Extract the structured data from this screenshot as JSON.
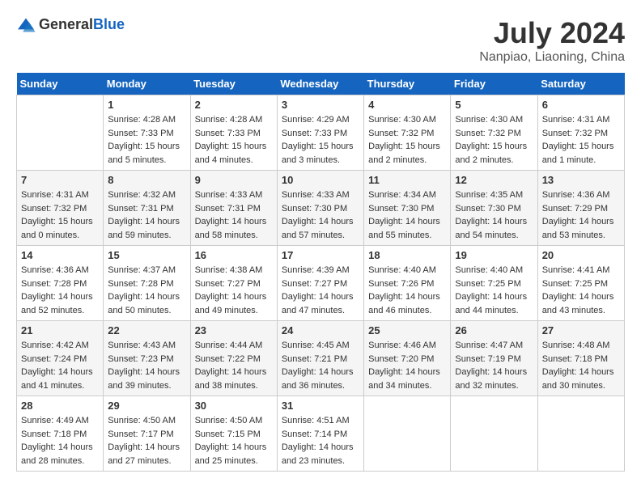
{
  "header": {
    "logo_general": "General",
    "logo_blue": "Blue",
    "month_year": "July 2024",
    "location": "Nanpiao, Liaoning, China"
  },
  "days_of_week": [
    "Sunday",
    "Monday",
    "Tuesday",
    "Wednesday",
    "Thursday",
    "Friday",
    "Saturday"
  ],
  "weeks": [
    [
      {
        "day": "",
        "sunrise": "",
        "sunset": "",
        "daylight": ""
      },
      {
        "day": "1",
        "sunrise": "Sunrise: 4:28 AM",
        "sunset": "Sunset: 7:33 PM",
        "daylight": "Daylight: 15 hours and 5 minutes."
      },
      {
        "day": "2",
        "sunrise": "Sunrise: 4:28 AM",
        "sunset": "Sunset: 7:33 PM",
        "daylight": "Daylight: 15 hours and 4 minutes."
      },
      {
        "day": "3",
        "sunrise": "Sunrise: 4:29 AM",
        "sunset": "Sunset: 7:33 PM",
        "daylight": "Daylight: 15 hours and 3 minutes."
      },
      {
        "day": "4",
        "sunrise": "Sunrise: 4:30 AM",
        "sunset": "Sunset: 7:32 PM",
        "daylight": "Daylight: 15 hours and 2 minutes."
      },
      {
        "day": "5",
        "sunrise": "Sunrise: 4:30 AM",
        "sunset": "Sunset: 7:32 PM",
        "daylight": "Daylight: 15 hours and 2 minutes."
      },
      {
        "day": "6",
        "sunrise": "Sunrise: 4:31 AM",
        "sunset": "Sunset: 7:32 PM",
        "daylight": "Daylight: 15 hours and 1 minute."
      }
    ],
    [
      {
        "day": "7",
        "sunrise": "Sunrise: 4:31 AM",
        "sunset": "Sunset: 7:32 PM",
        "daylight": "Daylight: 15 hours and 0 minutes."
      },
      {
        "day": "8",
        "sunrise": "Sunrise: 4:32 AM",
        "sunset": "Sunset: 7:31 PM",
        "daylight": "Daylight: 14 hours and 59 minutes."
      },
      {
        "day": "9",
        "sunrise": "Sunrise: 4:33 AM",
        "sunset": "Sunset: 7:31 PM",
        "daylight": "Daylight: 14 hours and 58 minutes."
      },
      {
        "day": "10",
        "sunrise": "Sunrise: 4:33 AM",
        "sunset": "Sunset: 7:30 PM",
        "daylight": "Daylight: 14 hours and 57 minutes."
      },
      {
        "day": "11",
        "sunrise": "Sunrise: 4:34 AM",
        "sunset": "Sunset: 7:30 PM",
        "daylight": "Daylight: 14 hours and 55 minutes."
      },
      {
        "day": "12",
        "sunrise": "Sunrise: 4:35 AM",
        "sunset": "Sunset: 7:30 PM",
        "daylight": "Daylight: 14 hours and 54 minutes."
      },
      {
        "day": "13",
        "sunrise": "Sunrise: 4:36 AM",
        "sunset": "Sunset: 7:29 PM",
        "daylight": "Daylight: 14 hours and 53 minutes."
      }
    ],
    [
      {
        "day": "14",
        "sunrise": "Sunrise: 4:36 AM",
        "sunset": "Sunset: 7:28 PM",
        "daylight": "Daylight: 14 hours and 52 minutes."
      },
      {
        "day": "15",
        "sunrise": "Sunrise: 4:37 AM",
        "sunset": "Sunset: 7:28 PM",
        "daylight": "Daylight: 14 hours and 50 minutes."
      },
      {
        "day": "16",
        "sunrise": "Sunrise: 4:38 AM",
        "sunset": "Sunset: 7:27 PM",
        "daylight": "Daylight: 14 hours and 49 minutes."
      },
      {
        "day": "17",
        "sunrise": "Sunrise: 4:39 AM",
        "sunset": "Sunset: 7:27 PM",
        "daylight": "Daylight: 14 hours and 47 minutes."
      },
      {
        "day": "18",
        "sunrise": "Sunrise: 4:40 AM",
        "sunset": "Sunset: 7:26 PM",
        "daylight": "Daylight: 14 hours and 46 minutes."
      },
      {
        "day": "19",
        "sunrise": "Sunrise: 4:40 AM",
        "sunset": "Sunset: 7:25 PM",
        "daylight": "Daylight: 14 hours and 44 minutes."
      },
      {
        "day": "20",
        "sunrise": "Sunrise: 4:41 AM",
        "sunset": "Sunset: 7:25 PM",
        "daylight": "Daylight: 14 hours and 43 minutes."
      }
    ],
    [
      {
        "day": "21",
        "sunrise": "Sunrise: 4:42 AM",
        "sunset": "Sunset: 7:24 PM",
        "daylight": "Daylight: 14 hours and 41 minutes."
      },
      {
        "day": "22",
        "sunrise": "Sunrise: 4:43 AM",
        "sunset": "Sunset: 7:23 PM",
        "daylight": "Daylight: 14 hours and 39 minutes."
      },
      {
        "day": "23",
        "sunrise": "Sunrise: 4:44 AM",
        "sunset": "Sunset: 7:22 PM",
        "daylight": "Daylight: 14 hours and 38 minutes."
      },
      {
        "day": "24",
        "sunrise": "Sunrise: 4:45 AM",
        "sunset": "Sunset: 7:21 PM",
        "daylight": "Daylight: 14 hours and 36 minutes."
      },
      {
        "day": "25",
        "sunrise": "Sunrise: 4:46 AM",
        "sunset": "Sunset: 7:20 PM",
        "daylight": "Daylight: 14 hours and 34 minutes."
      },
      {
        "day": "26",
        "sunrise": "Sunrise: 4:47 AM",
        "sunset": "Sunset: 7:19 PM",
        "daylight": "Daylight: 14 hours and 32 minutes."
      },
      {
        "day": "27",
        "sunrise": "Sunrise: 4:48 AM",
        "sunset": "Sunset: 7:18 PM",
        "daylight": "Daylight: 14 hours and 30 minutes."
      }
    ],
    [
      {
        "day": "28",
        "sunrise": "Sunrise: 4:49 AM",
        "sunset": "Sunset: 7:18 PM",
        "daylight": "Daylight: 14 hours and 28 minutes."
      },
      {
        "day": "29",
        "sunrise": "Sunrise: 4:50 AM",
        "sunset": "Sunset: 7:17 PM",
        "daylight": "Daylight: 14 hours and 27 minutes."
      },
      {
        "day": "30",
        "sunrise": "Sunrise: 4:50 AM",
        "sunset": "Sunset: 7:15 PM",
        "daylight": "Daylight: 14 hours and 25 minutes."
      },
      {
        "day": "31",
        "sunrise": "Sunrise: 4:51 AM",
        "sunset": "Sunset: 7:14 PM",
        "daylight": "Daylight: 14 hours and 23 minutes."
      },
      {
        "day": "",
        "sunrise": "",
        "sunset": "",
        "daylight": ""
      },
      {
        "day": "",
        "sunrise": "",
        "sunset": "",
        "daylight": ""
      },
      {
        "day": "",
        "sunrise": "",
        "sunset": "",
        "daylight": ""
      }
    ]
  ]
}
